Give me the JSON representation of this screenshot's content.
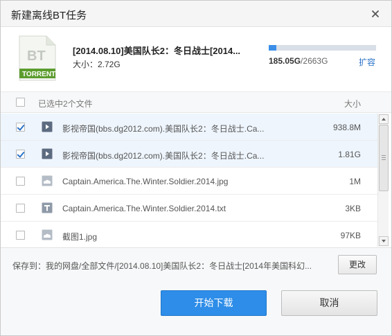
{
  "dialog": {
    "title": "新建离线BT任务",
    "close_icon": "close-icon"
  },
  "torrent": {
    "icon_label": "BT",
    "icon_badge": "TORRENT",
    "name": "[2014.08.10]美国队长2：冬日战士[2014...",
    "size_label": "大小：2.72G"
  },
  "quota": {
    "used": "185.05G",
    "separator": "/",
    "total": "2663G",
    "fraction_used": 0.0695,
    "expand_label": "扩容",
    "bar_color": "#3b8ee8"
  },
  "list": {
    "selected_text": "已选中2个文件",
    "size_header": "大小",
    "files": [
      {
        "name": "影视帝国(bbs.dg2012.com).美国队长2：冬日战士.Ca...",
        "size": "938.8M",
        "checked": true,
        "icon": "video-file-icon"
      },
      {
        "name": "影视帝国(bbs.dg2012.com).美国队长2：冬日战士.Ca...",
        "size": "1.81G",
        "checked": true,
        "icon": "video-file-icon"
      },
      {
        "name": "Captain.America.The.Winter.Soldier.2014.jpg",
        "size": "1M",
        "checked": false,
        "icon": "image-file-icon"
      },
      {
        "name": "Captain.America.The.Winter.Soldier.2014.txt",
        "size": "3KB",
        "checked": false,
        "icon": "text-file-icon"
      },
      {
        "name": "截图1.jpg",
        "size": "97KB",
        "checked": false,
        "icon": "image-file-icon"
      }
    ]
  },
  "save": {
    "label": "保存到：",
    "path": "我的网盘/全部文件/[2014.08.10]美国队长2：冬日战士[2014年美国科幻...",
    "change_label": "更改"
  },
  "footer": {
    "start_label": "开始下载",
    "cancel_label": "取消",
    "accent_color": "#2d8de8"
  }
}
